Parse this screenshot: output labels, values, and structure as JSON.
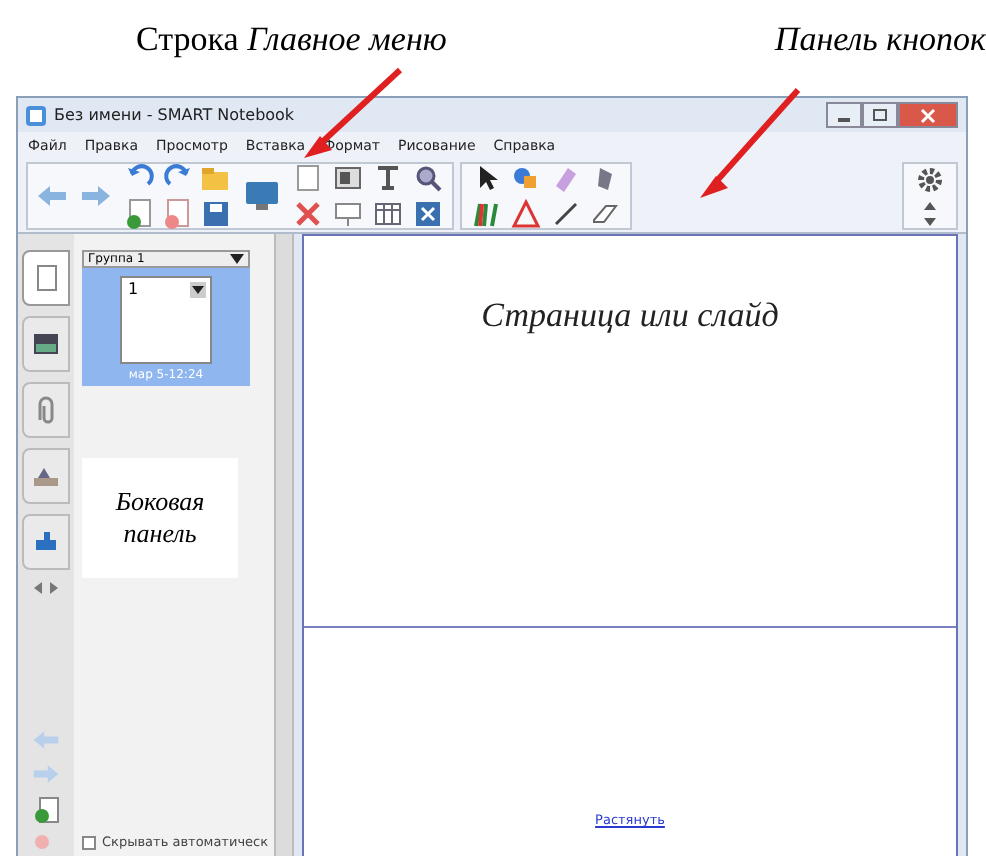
{
  "annotations": [
    {
      "kind": "menu",
      "text": "Строка *Главное меню*"
    },
    {
      "kind": "toolbar",
      "text": "*Панель кнопок*"
    }
  ],
  "window": {
    "title": "Без имени - SMART Notebook"
  },
  "menu": [
    "Файл",
    "Правка",
    "Просмотр",
    "Вставка",
    "Формат",
    "Рисование",
    "Справка"
  ],
  "sidebar": {
    "tabs": [
      {
        "selected": true
      },
      {
        "selected": false
      },
      {
        "selected": false
      },
      {
        "selected": false
      },
      {
        "selected": false
      }
    ],
    "group": "Группа 1",
    "pages": [
      {
        "number": "1",
        "caption": "мар 5-12:24",
        "selected": true
      }
    ],
    "note": "Боковая панель",
    "autohide": {
      "label": "Скрывать автоматическ",
      "checked": false
    }
  },
  "slide": {
    "note": "Страница или слайд",
    "link": "Растянуть"
  }
}
